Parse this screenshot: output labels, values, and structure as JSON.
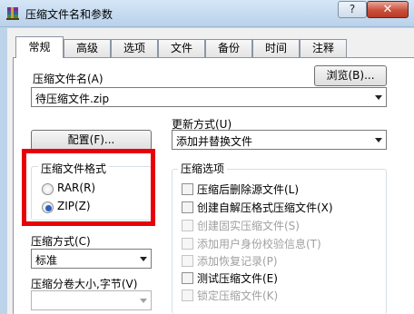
{
  "window": {
    "title": "压缩文件名和参数",
    "help_label": "?",
    "close_label": "✕"
  },
  "tabs": [
    {
      "label": "常规",
      "active": true
    },
    {
      "label": "高级"
    },
    {
      "label": "选项"
    },
    {
      "label": "文件"
    },
    {
      "label": "备份"
    },
    {
      "label": "时间"
    },
    {
      "label": "注释"
    }
  ],
  "general": {
    "archive_name_label": "压缩文件名(A)",
    "archive_name_value": "待压缩文件.zip",
    "browse_label": "浏览(B)...",
    "update_mode_label": "更新方式(U)",
    "update_mode_value": "添加并替换文件",
    "profiles_label": "配置(F)...",
    "format_group_title": "压缩文件格式",
    "format_rar": "RAR(R)",
    "format_zip": "ZIP(Z)",
    "selected_format": "ZIP",
    "method_label": "压缩方式(C)",
    "method_value": "标准",
    "volume_label": "压缩分卷大小,字节(V)",
    "volume_value": ""
  },
  "options": {
    "group_title": "压缩选项",
    "items": [
      {
        "label": "压缩后删除源文件(L)",
        "enabled": true,
        "checked": false
      },
      {
        "label": "创建自解压格式压缩文件(X)",
        "enabled": true,
        "checked": false
      },
      {
        "label": "创建固实压缩文件(S)",
        "enabled": false,
        "checked": false
      },
      {
        "label": "添加用户身份校验信息(T)",
        "enabled": false,
        "checked": false
      },
      {
        "label": "添加恢复记录(P)",
        "enabled": false,
        "checked": false
      },
      {
        "label": "测试压缩文件(E)",
        "enabled": true,
        "checked": false
      },
      {
        "label": "锁定压缩文件(K)",
        "enabled": false,
        "checked": false
      }
    ]
  },
  "colors": {
    "highlight": "#e8000b",
    "radio_dot": "#2c5fc5"
  }
}
